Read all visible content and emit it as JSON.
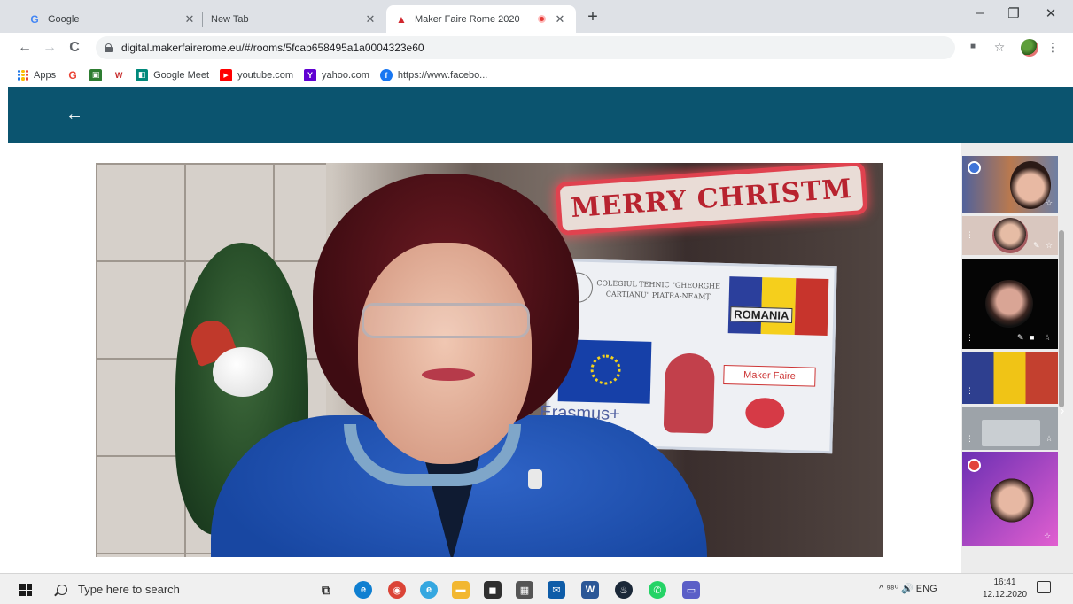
{
  "browser": {
    "tabs": [
      {
        "title": "Google",
        "favicon": "google-icon",
        "active": false
      },
      {
        "title": "New Tab",
        "favicon": "",
        "active": false
      },
      {
        "title": "Maker Faire Rome 2020",
        "favicon": "maker-faire-icon",
        "active": true,
        "recording": true
      }
    ],
    "new_tab_label": "+",
    "window_controls": {
      "minimize": "–",
      "restore": "❐",
      "close": "✕"
    },
    "nav": {
      "back": "←",
      "forward": "→",
      "reload": "C"
    },
    "url": "digital.makerfairerome.eu/#/rooms/5fcab658495a1a0004323e60",
    "toolbar_icons": {
      "camera": "■",
      "star": "☆",
      "menu": "⋮"
    }
  },
  "bookmarks": [
    {
      "label": "Apps",
      "icon": "apps-grid-icon"
    },
    {
      "label": "",
      "icon": "google-icon",
      "glyph": "G",
      "color": "#ea4335"
    },
    {
      "label": "",
      "icon": "image-bookmark-icon",
      "glyph": "▣",
      "color": "#2e7d32"
    },
    {
      "label": "",
      "icon": "w-bookmark-icon",
      "glyph": "W",
      "color": "#c62828"
    },
    {
      "label": "Google Meet",
      "icon": "google-meet-icon",
      "glyph": "◧",
      "color": "#00897b"
    },
    {
      "label": "youtube.com",
      "icon": "youtube-icon",
      "glyph": "▶",
      "color": "#ff0000"
    },
    {
      "label": "yahoo.com",
      "icon": "yahoo-icon",
      "glyph": "Y",
      "color": "#6001d2"
    },
    {
      "label": "https://www.facebo...",
      "icon": "facebook-icon",
      "glyph": "f",
      "color": "#1877f2"
    }
  ],
  "app": {
    "header_color": "#0b546f",
    "back_label": "←"
  },
  "video": {
    "banner_text": "MERRY CHRISTM",
    "poster": {
      "school": "COLEGIUL TEHNIC \"GHEORGHE CARTIANU\" PIATRA-NEAMȚ",
      "country": "ROMANIA",
      "program": "Erasmus+",
      "event": "Maker Faire"
    }
  },
  "taskbar": {
    "search_placeholder": "Type here to search",
    "tray_text": "^  ⁹⁸⁰  🔊  ENG",
    "time": "16:41",
    "date": "12.12.2020",
    "apps": [
      {
        "name": "task-view-icon",
        "glyph": "⧉",
        "color": "#3a3a3a"
      },
      {
        "name": "edge-icon",
        "glyph": "e",
        "color": "#0f7fd1"
      },
      {
        "name": "chrome-icon",
        "glyph": "◉",
        "color": "#db4437"
      },
      {
        "name": "ie-icon",
        "glyph": "e",
        "color": "#35a7e0"
      },
      {
        "name": "file-explorer-icon",
        "glyph": "▬",
        "color": "#f2b731"
      },
      {
        "name": "store-icon",
        "glyph": "◼",
        "color": "#303030"
      },
      {
        "name": "calculator-icon",
        "glyph": "▦",
        "color": "#555"
      },
      {
        "name": "mail-icon",
        "glyph": "✉",
        "color": "#0e5ca8"
      },
      {
        "name": "word-icon",
        "glyph": "W",
        "color": "#2b5797"
      },
      {
        "name": "steam-icon",
        "glyph": "♨",
        "color": "#1b2838"
      },
      {
        "name": "whatsapp-icon",
        "glyph": "✆",
        "color": "#25d366"
      },
      {
        "name": "chat-icon",
        "glyph": "▭",
        "color": "#5b5fc7"
      }
    ]
  }
}
